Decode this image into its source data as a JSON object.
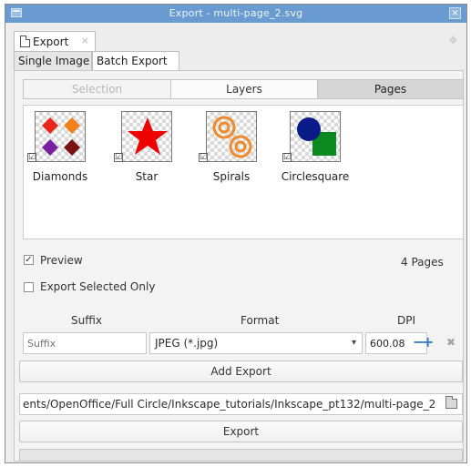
{
  "window": {
    "title": "Export - multi-page_2.svg",
    "close_glyph": "×"
  },
  "dock": {
    "tab_label": "Export",
    "tab_close": "×",
    "float_glyph": "✥"
  },
  "subtabs": [
    "Single Image",
    "Batch Export"
  ],
  "modes": {
    "selection": "Selection",
    "layers": "Layers",
    "pages": "Pages",
    "active": "Pages"
  },
  "pages": [
    {
      "name": "Diamonds",
      "checked": true,
      "check_glyph": "☑"
    },
    {
      "name": "Star",
      "checked": true,
      "check_glyph": "☑"
    },
    {
      "name": "Spirals",
      "checked": true,
      "check_glyph": "☑"
    },
    {
      "name": "Circlesquare",
      "checked": true,
      "check_glyph": "☑"
    }
  ],
  "options": {
    "preview_label": "Preview",
    "preview_checked": true,
    "preview_glyph": "✓",
    "export_selected_label": "Export Selected Only",
    "export_selected_checked": false,
    "page_count": "4 Pages"
  },
  "columns": {
    "suffix": "Suffix",
    "format": "Format",
    "dpi": "DPI"
  },
  "row": {
    "suffix_placeholder": "Suffix",
    "format_value": "JPEG (*.jpg)",
    "format_arrow": "▾",
    "dpi_value": "600.08",
    "minus": "−",
    "plus": "+",
    "remove": "✖"
  },
  "add_export_label": "Add Export",
  "path_value": "ents/OpenOffice/Full Circle/Inkscape_tutorials/Inkscape_pt132/multi-page_2",
  "export_label": "Export",
  "progress_fraction": 0,
  "colors": {
    "titlebar": "#6a9bd0",
    "diamond_red": "#e8261c",
    "diamond_orange": "#f37f1c",
    "diamond_purple": "#7b1fa2",
    "diamond_darkred": "#7a1212",
    "star": "#ee0000",
    "spiral": "#f08a2a",
    "circle": "#0a1a88",
    "square": "#0a8a1e",
    "dpi_buttons": "#3a7fc4"
  }
}
